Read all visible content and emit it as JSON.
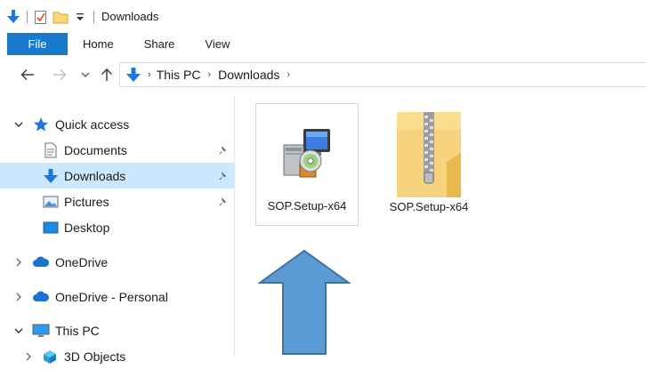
{
  "window": {
    "title": "Downloads",
    "qat_icons": [
      "down-arrow-icon",
      "properties-check-icon",
      "new-folder-icon",
      "customize-qat-icon"
    ]
  },
  "ribbon": {
    "tabs": [
      {
        "label": "File",
        "active": true
      },
      {
        "label": "Home"
      },
      {
        "label": "Share"
      },
      {
        "label": "View"
      }
    ]
  },
  "address": {
    "breadcrumbs": [
      "This PC",
      "Downloads"
    ]
  },
  "nav_pane": {
    "items": [
      {
        "label": "Quick access",
        "icon": "star-icon",
        "expanded": true
      },
      {
        "label": "Documents",
        "icon": "documents-icon",
        "pinned": true
      },
      {
        "label": "Downloads",
        "icon": "downloads-icon",
        "pinned": true,
        "selected": true
      },
      {
        "label": "Pictures",
        "icon": "pictures-icon",
        "pinned": true
      },
      {
        "label": "Desktop",
        "icon": "desktop-icon"
      },
      {
        "label": "OneDrive",
        "icon": "cloud-icon",
        "expanded": false
      },
      {
        "label": "OneDrive - Personal",
        "icon": "cloud-icon",
        "expanded": false
      },
      {
        "label": "This PC",
        "icon": "computer-icon",
        "expanded": true
      },
      {
        "label": "3D Objects",
        "icon": "3d-objects-icon",
        "expanded": false
      }
    ]
  },
  "files": [
    {
      "name": "SOP.Setup-x64",
      "type": "installer",
      "icon": "installer-icon",
      "selected": true
    },
    {
      "name": "SOP.Setup-x64",
      "type": "zip",
      "icon": "zip-folder-icon"
    }
  ],
  "colors": {
    "accent": "#1979ca",
    "selection": "#cce8ff",
    "arrow": "#5b9bd5",
    "arrow_border": "#41719c"
  }
}
